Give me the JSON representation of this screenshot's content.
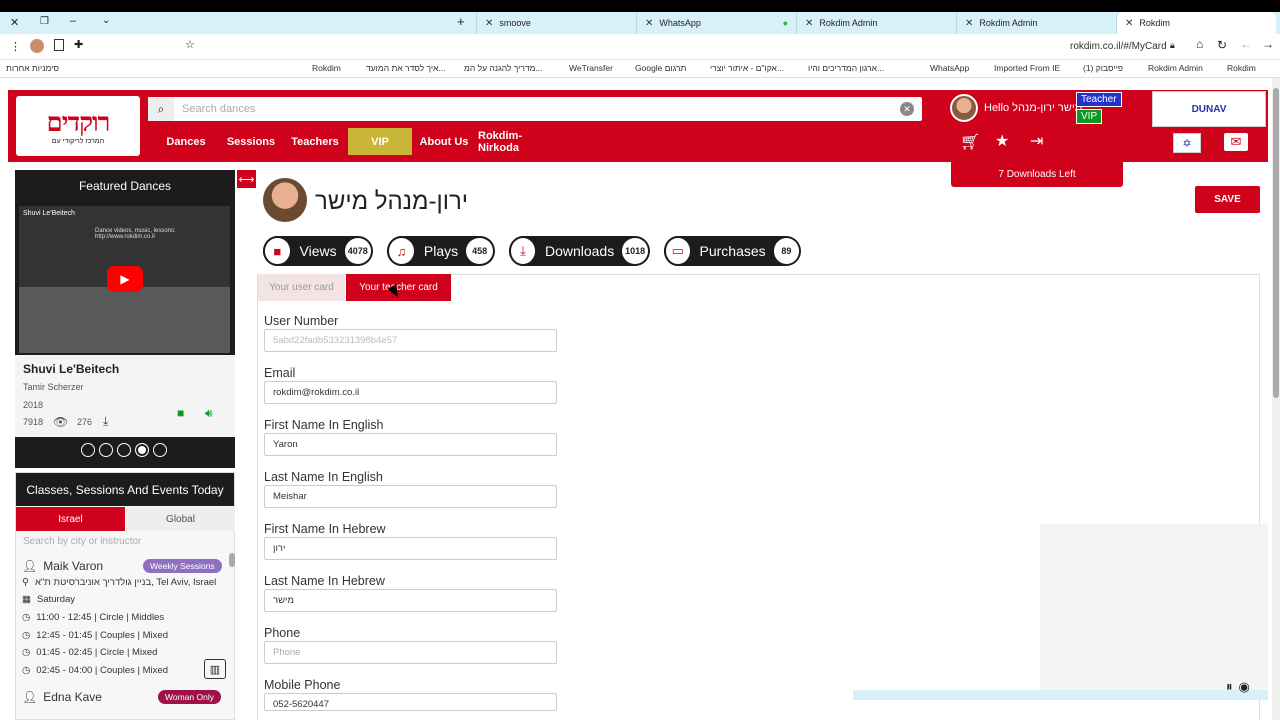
{
  "browser": {
    "tabs": [
      {
        "label": "smoove",
        "active": false
      },
      {
        "label": "WhatsApp",
        "active": false
      },
      {
        "label": "Rokdim Admin",
        "active": false
      },
      {
        "label": "Rokdim Admin",
        "active": false
      },
      {
        "label": "Rokdim",
        "active": true
      }
    ],
    "url": "rokdim.co.il/#/MyCard",
    "bookmarks": [
      "סימניות אחרות",
      "Rokdim",
      "איך לסדר את המועד...",
      "מדריך להגנה על המ...",
      "WeTransfer",
      "Google תרגום",
      "אקו\"ם - איתור יוצרי...",
      "ארגון המדריכים והיו...",
      "WhatsApp",
      "Imported From IE",
      "(1) פייסבוק",
      "Rokdim Admin",
      "Rokdim"
    ]
  },
  "header": {
    "logo_text": "רוקדים",
    "logo_sub": "המרכז לריקודי עם",
    "search_placeholder": "Search dances",
    "nav": [
      "Dances",
      "Sessions",
      "Teachers",
      "VIP",
      "About Us",
      "Rokdim-Nirkoda"
    ],
    "hello_text": "Hello מישר ירון-מנהל",
    "badge_teacher": "Teacher",
    "badge_vip": "VIP",
    "dunav_text": "DUNAV",
    "downloads_left": "7 Downloads Left"
  },
  "sidebar": {
    "featured_title": "Featured Dances",
    "video_title": "Shuvi Le'Beitech",
    "video_subtitle": "Dance videos, music, lessons: http://www.rokdim.co.il",
    "dance_name": "Shuvi Le'Beitech",
    "dance_author": "Tamir Scherzer",
    "dance_year": "2018",
    "views": "7918",
    "downloads": "276",
    "carousel_dots": 5,
    "carousel_active": 3,
    "events_title": "Classes, Sessions And Events Today",
    "tab_israel": "Israel",
    "tab_global": "Global",
    "events_search_placeholder": "Search by city or instructor",
    "event1": {
      "instructor": "Maik Varon",
      "tag": "Weekly Sessions",
      "location": "בניין גולדריך אוניברסיטת ת\"א, Tel Aviv, Israel",
      "day": "Saturday",
      "times": [
        "11:00 - 12:45 | Circle | Middles",
        "12:45 - 01:45 | Couples | Mixed",
        "01:45 - 02:45 | Circle | Mixed",
        "02:45 - 04:00 | Couples | Mixed"
      ]
    },
    "event2": {
      "instructor": "Edna Kave",
      "tag": "Woman Only"
    }
  },
  "profile": {
    "name": "ירון-מנהל מישר",
    "save_label": "SAVE",
    "stats": [
      {
        "label": "Views",
        "count": "4078",
        "icon": "video-icon"
      },
      {
        "label": "Plays",
        "count": "458",
        "icon": "music-icon"
      },
      {
        "label": "Downloads",
        "count": "1018",
        "icon": "download-icon"
      },
      {
        "label": "Purchases",
        "count": "89",
        "icon": "credit-card-icon"
      }
    ],
    "tab_user": "Your user card",
    "tab_teacher": "Your teacher card",
    "fields": [
      {
        "label": "User Number",
        "value": "5abd22fadb533231398b4e57",
        "placeholder": ""
      },
      {
        "label": "Email",
        "value": "rokdim@rokdim.co.il",
        "placeholder": ""
      },
      {
        "label": "First Name In English",
        "value": "Yaron",
        "placeholder": ""
      },
      {
        "label": "Last Name In English",
        "value": "Meishar",
        "placeholder": ""
      },
      {
        "label": "First Name In Hebrew",
        "value": "ירון",
        "placeholder": ""
      },
      {
        "label": "Last Name In Hebrew",
        "value": "מישר",
        "placeholder": ""
      },
      {
        "label": "Phone",
        "value": "",
        "placeholder": "Phone"
      },
      {
        "label": "Mobile Phone",
        "value": "052-5620447",
        "placeholder": ""
      }
    ]
  },
  "colors": {
    "brand_red": "#d0011b",
    "dark": "#1c1c1c",
    "vip_gold": "#c9b537",
    "tag_purple": "#8e6fc0",
    "tag_maroon": "#a0104a"
  }
}
